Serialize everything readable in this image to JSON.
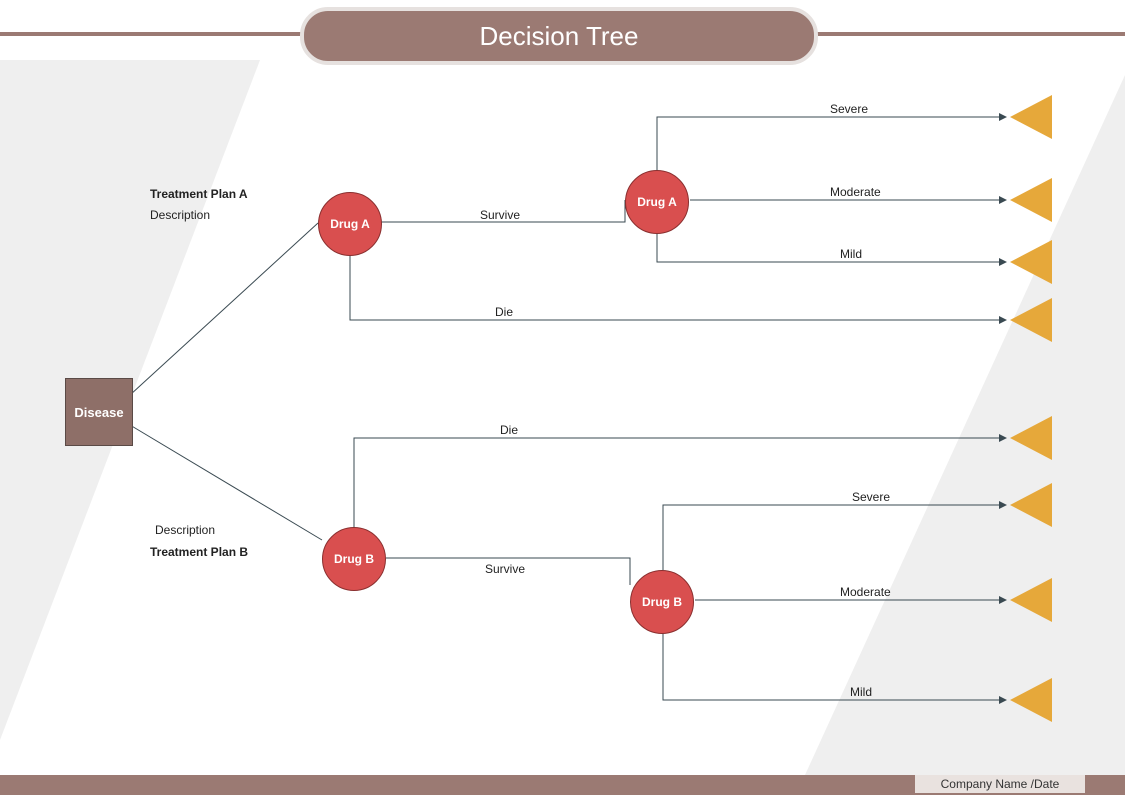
{
  "title": "Decision Tree",
  "footer": "Company Name /Date",
  "root": {
    "label": "Disease"
  },
  "branches": {
    "a": {
      "plan_label": "Treatment Plan A",
      "desc_label": "Description",
      "drug_first": "Drug A",
      "survive": "Survive",
      "die": "Die",
      "drug_second": "Drug A",
      "outcomes": {
        "severe": "Severe",
        "moderate": "Moderate",
        "mild": "Mild"
      }
    },
    "b": {
      "plan_label": "Treatment Plan B",
      "desc_label": "Description",
      "drug_first": "Drug  B",
      "survive": "Survive",
      "die": "Die",
      "drug_second": "Drug  B",
      "outcomes": {
        "severe": "Severe",
        "moderate": "Moderate",
        "mild": "Mild"
      }
    }
  }
}
